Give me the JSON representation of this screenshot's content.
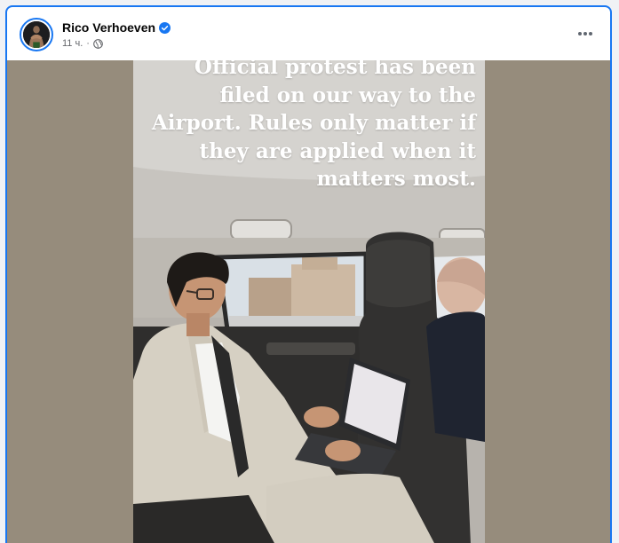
{
  "post": {
    "author": {
      "name": "Rico Verhoeven",
      "verified": true
    },
    "timestamp": "11 ч.",
    "separator": "·",
    "audience_icon": "globe-icon",
    "more_icon": "more-horizontal-icon",
    "media": {
      "caption_text": "Official protest has been filed on our way to the Airport. Rules only matter if they are applied when it matters most."
    }
  },
  "colors": {
    "accent": "#1877f2",
    "media_background": "#968c7c",
    "name_text": "#050505",
    "meta_text": "#65676b"
  }
}
